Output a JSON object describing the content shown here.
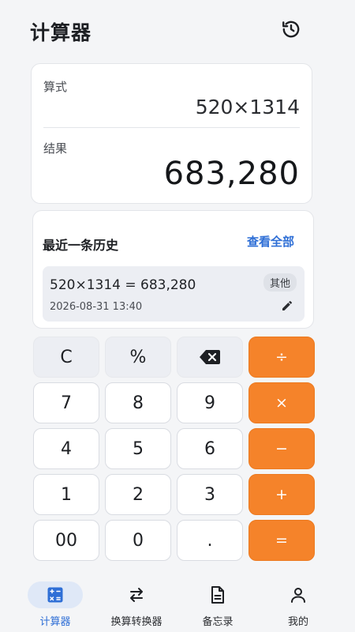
{
  "header": {
    "title": "计算器",
    "history_icon": "history-icon"
  },
  "display": {
    "expression_label": "算式",
    "expression": "520×1314",
    "result_label": "结果",
    "result": "683,280"
  },
  "history": {
    "title": "最近一条历史",
    "view_all": "查看全部",
    "item": {
      "expression": "520×1314 = 683,280",
      "timestamp": "2026-08-31  13:40",
      "tag": "其他"
    }
  },
  "keypad": {
    "clear": "C",
    "percent": "%",
    "divide": "÷",
    "seven": "7",
    "eight": "8",
    "nine": "9",
    "multiply": "×",
    "four": "4",
    "five": "5",
    "six": "6",
    "minus": "−",
    "one": "1",
    "two": "2",
    "three": "3",
    "plus": "+",
    "double_zero": "00",
    "zero": "0",
    "dot": ".",
    "equals": "="
  },
  "nav": {
    "items": [
      {
        "label": "计算器",
        "icon": "calculator-icon",
        "active": true
      },
      {
        "label": "换算转换器",
        "icon": "swap-icon",
        "active": false
      },
      {
        "label": "备忘录",
        "icon": "document-icon",
        "active": false
      },
      {
        "label": "我的",
        "icon": "user-icon",
        "active": false
      }
    ]
  },
  "colors": {
    "accent": "#f5832a",
    "link": "#2f6fd6",
    "background": "#f4f5f7"
  }
}
